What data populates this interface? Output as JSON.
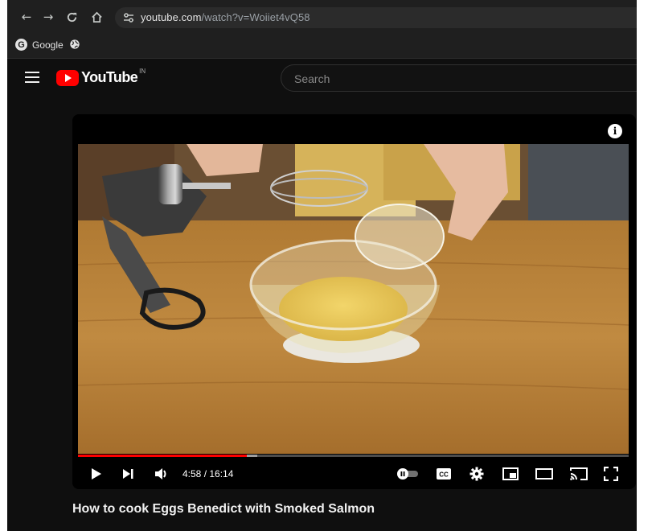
{
  "browser": {
    "url_host": "youtube.com",
    "url_path": "/watch?v=Woiiet4vQ58",
    "bookmarks": [
      {
        "label": "Google"
      }
    ]
  },
  "header": {
    "logo_text": "YouTube",
    "country_code": "IN",
    "search_placeholder": "Search"
  },
  "player": {
    "current_time": "4:58",
    "duration": "16:14",
    "time_display": "4:58 / 16:14",
    "progress_fraction": 0.307,
    "buffered_fraction": 0.325,
    "info_icon": "info-icon",
    "controls": [
      "play-icon",
      "next-icon",
      "volume-icon",
      "autoplay-toggle",
      "captions-icon",
      "settings-icon",
      "miniplayer-icon",
      "theater-mode-icon",
      "cast-icon",
      "fullscreen-icon"
    ],
    "captions_label": "CC"
  },
  "video": {
    "title": "How to cook Eggs Benedict with Smoked Salmon"
  },
  "colors": {
    "brand_red": "#ff0000",
    "background": "#0f0f0f"
  }
}
